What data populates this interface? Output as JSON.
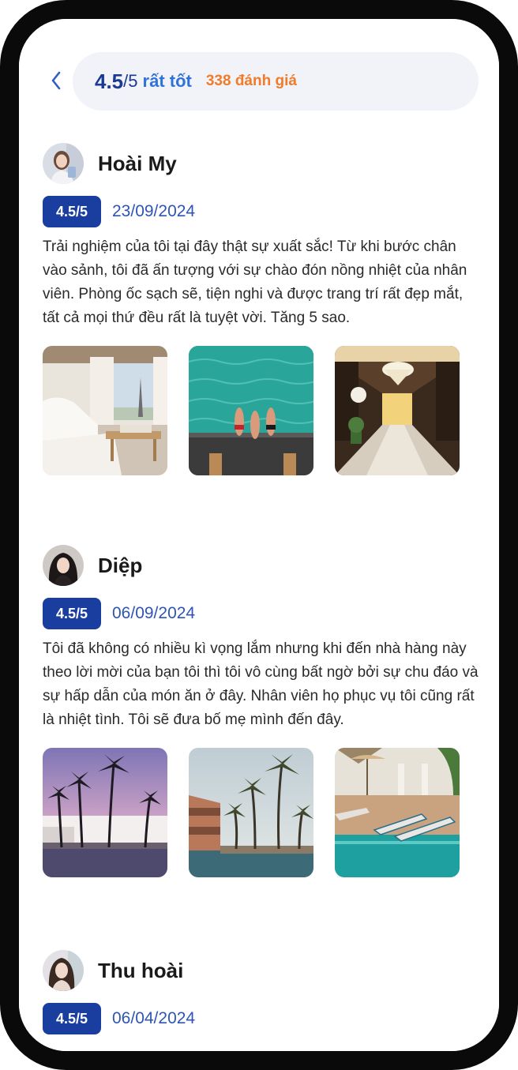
{
  "header": {
    "score": "4.5",
    "denominator": "/5",
    "rating_word": "rất tốt",
    "review_count": "338 đánh giá"
  },
  "reviews": [
    {
      "name": "Hoài My",
      "score": "4.5/5",
      "date": "23/09/2024",
      "text": "Trải nghiệm của tôi tại đây thật sự xuất sắc! Từ khi bước chân vào sảnh, tôi đã ấn tượng với sự chào đón nồng nhiệt của nhân viên. Phòng ốc sạch sẽ, tiện nghi và được trang trí rất đẹp mắt, tất cả mọi thứ đều rất là tuyệt vời. Tăng 5 sao.",
      "photos": [
        "bedroom-eiffel-view",
        "pool-swimmers",
        "marble-lobby-chandelier"
      ]
    },
    {
      "name": "Diệp",
      "score": "4.5/5",
      "date": "06/09/2024",
      "text": "Tôi đã không có nhiều kì vọng lắm nhưng khi đến nhà hàng này theo lời mời của bạn tôi thì tôi vô cùng bất ngờ bởi sự chu đáo và sự hấp dẫn của món ăn ở đây. Nhân viên họ phục vụ tôi cũng rất là nhiệt tình. Tôi sẽ đưa bố mẹ mình đến đây.",
      "photos": [
        "palm-resort-sunset",
        "palm-beach-resort",
        "poolside-loungers"
      ]
    },
    {
      "name": "Thu hoài",
      "score": "4.5/5",
      "date": "06/04/2024",
      "text": "",
      "photos": []
    }
  ],
  "colors": {
    "primary": "#1a3ea0",
    "accent_blue": "#2f73d9",
    "accent_orange": "#f07b2a",
    "pill_bg": "#f1f3f8"
  },
  "icons": {
    "back": "chevron-left-icon"
  }
}
